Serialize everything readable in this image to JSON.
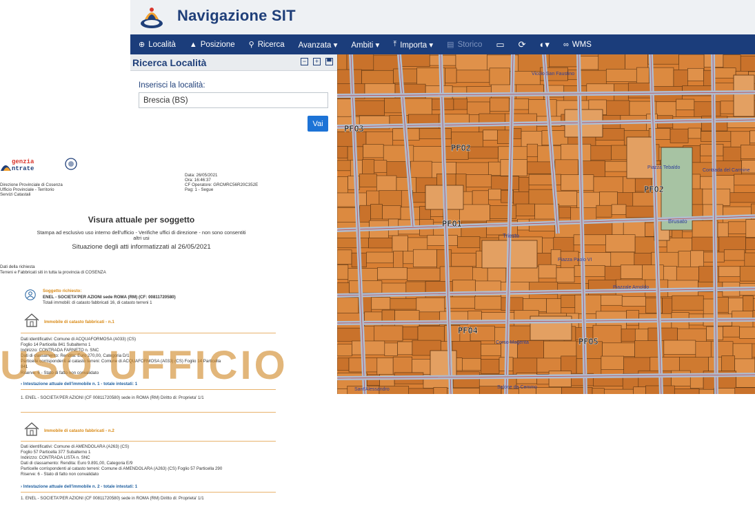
{
  "sit": {
    "title": "Navigazione SIT",
    "nav": [
      {
        "label": "Località",
        "icon": "globe-icon"
      },
      {
        "label": "Posizione",
        "icon": "map-marker-icon"
      },
      {
        "label": "Ricerca",
        "icon": "search-icon"
      },
      {
        "label": "Avanzata ▾",
        "icon": ""
      },
      {
        "label": "Ambiti ▾",
        "icon": ""
      },
      {
        "label": "Importa ▾",
        "icon": "upload-icon"
      },
      {
        "label": "Storico",
        "icon": "history-icon"
      }
    ],
    "nav_icons": [
      "monitor-icon",
      "refresh-icon",
      "contrast-icon",
      "link-icon"
    ],
    "wms_label": "WMS",
    "panel": {
      "title": "Ricerca Località",
      "input_label": "Inserisci la località:",
      "input_value": "Brescia (BS)",
      "go_label": "Vai"
    },
    "map_labels": [
      "PF03",
      "PF02",
      "PF02",
      "PF01",
      "PF04",
      "PF05",
      "Piazza Tebaldo",
      "Brusato",
      "Trieste",
      "Piazza Paolo VI",
      "Piazzale Arnoldo",
      "Salone da Cemmo",
      "Corso Magenta",
      "Sant'Alessandro",
      "Vicolo San Faustino",
      "Contrada del Carmine"
    ],
    "colors": {
      "nav_bg": "#1b3d7b",
      "brand": "#1f3f79",
      "accent": "#1d73d6",
      "parcel": "#d97f33",
      "street": "#b0bccf"
    }
  },
  "doc": {
    "logo_text": "genzia\nntrate",
    "office": [
      "Direzione Provinciale di Cosenza",
      "Ufficio Provinciale - Territorio",
      "Servizi Catastali"
    ],
    "meta": [
      "Data: 26/05/2021",
      "Ora: 16:46:37",
      "CF Operatore: GRCMRC56R20C352E",
      "Pag: 1 - Segue"
    ],
    "title": "Visura attuale per soggetto",
    "subtitle1": "Stampa ad esclusivo uso interno dell'ufficio - Verifiche uffici di direzione - non sono consentiti",
    "subtitle2": "altri usi",
    "situation": "Situazione degli atti informatizzati al 26/05/2021",
    "request_label": "Dati della richiesta",
    "request_value": "Terreni e Fabbricati siti in tutta la provincia di COSENZA",
    "subject_heading": "Soggetto richiesto:",
    "subject_line": "ENEL - SOCIETA'PER AZIONI   sede ROMA (RM) (CF: 00811720580)",
    "subject_totals": "Totali immobili: di catasto fabbricati 16,  di catasto terreni 1",
    "immobile1": {
      "heading": "Immobile di catasto fabbricati - n.1",
      "lines": [
        "Dati identificativi: Comune di ACQUAFORMOSA (A033) (CS)",
        "Foglio 14 Particella 841 Subalterno 1",
        "Indirizzo: CONTRADA FARNETO n. SNC",
        "Dati di classamento: Rendita: Euro 270,00, Categoria D/1",
        "Particelle corrispondenti al catasto terreni: Comune di ACQUAFORMOSA (A033) (CS) Foglio 14 Particella",
        "841",
        "Riserve: 6 - Stato di fatto non convalidato"
      ],
      "intest_heading": "Intestazione attuale dell'immobile n. 1 - totale intestati: 1",
      "intest_line": "1. ENEL - SOCIETA'PER AZIONI  (CF 00811720580) sede in ROMA (RM)   Diritto di: Proprieta' 1/1"
    },
    "immobile2": {
      "heading": "Immobile di catasto fabbricati - n.2",
      "lines": [
        "Dati identificativi: Comune di AMENDOLARA (A263) (CS)",
        "Foglio 57 Particella 377 Subalterno 1",
        "Indirizzo: CONTRADA LISTA n. SNC",
        "Dati di classamento: Rendita: Euro 9.891,00, Categoria E/9",
        "Particelle corrispondenti al catasto terreni: Comune di AMENDOLARA (A263) (CS) Foglio 57 Particella 290",
        "Riserve: 6 - Stato di fatto non convalidato"
      ],
      "intest_heading": "Intestazione attuale dell'immobile n. 2 - totale intestati: 1",
      "intest_line": "1. ENEL - SOCIETA'PER AZIONI  (CF 00811720580) sede in ROMA (RM)   Diritto di: Proprieta' 1/1"
    },
    "watermark": "USO UFFICIO"
  }
}
